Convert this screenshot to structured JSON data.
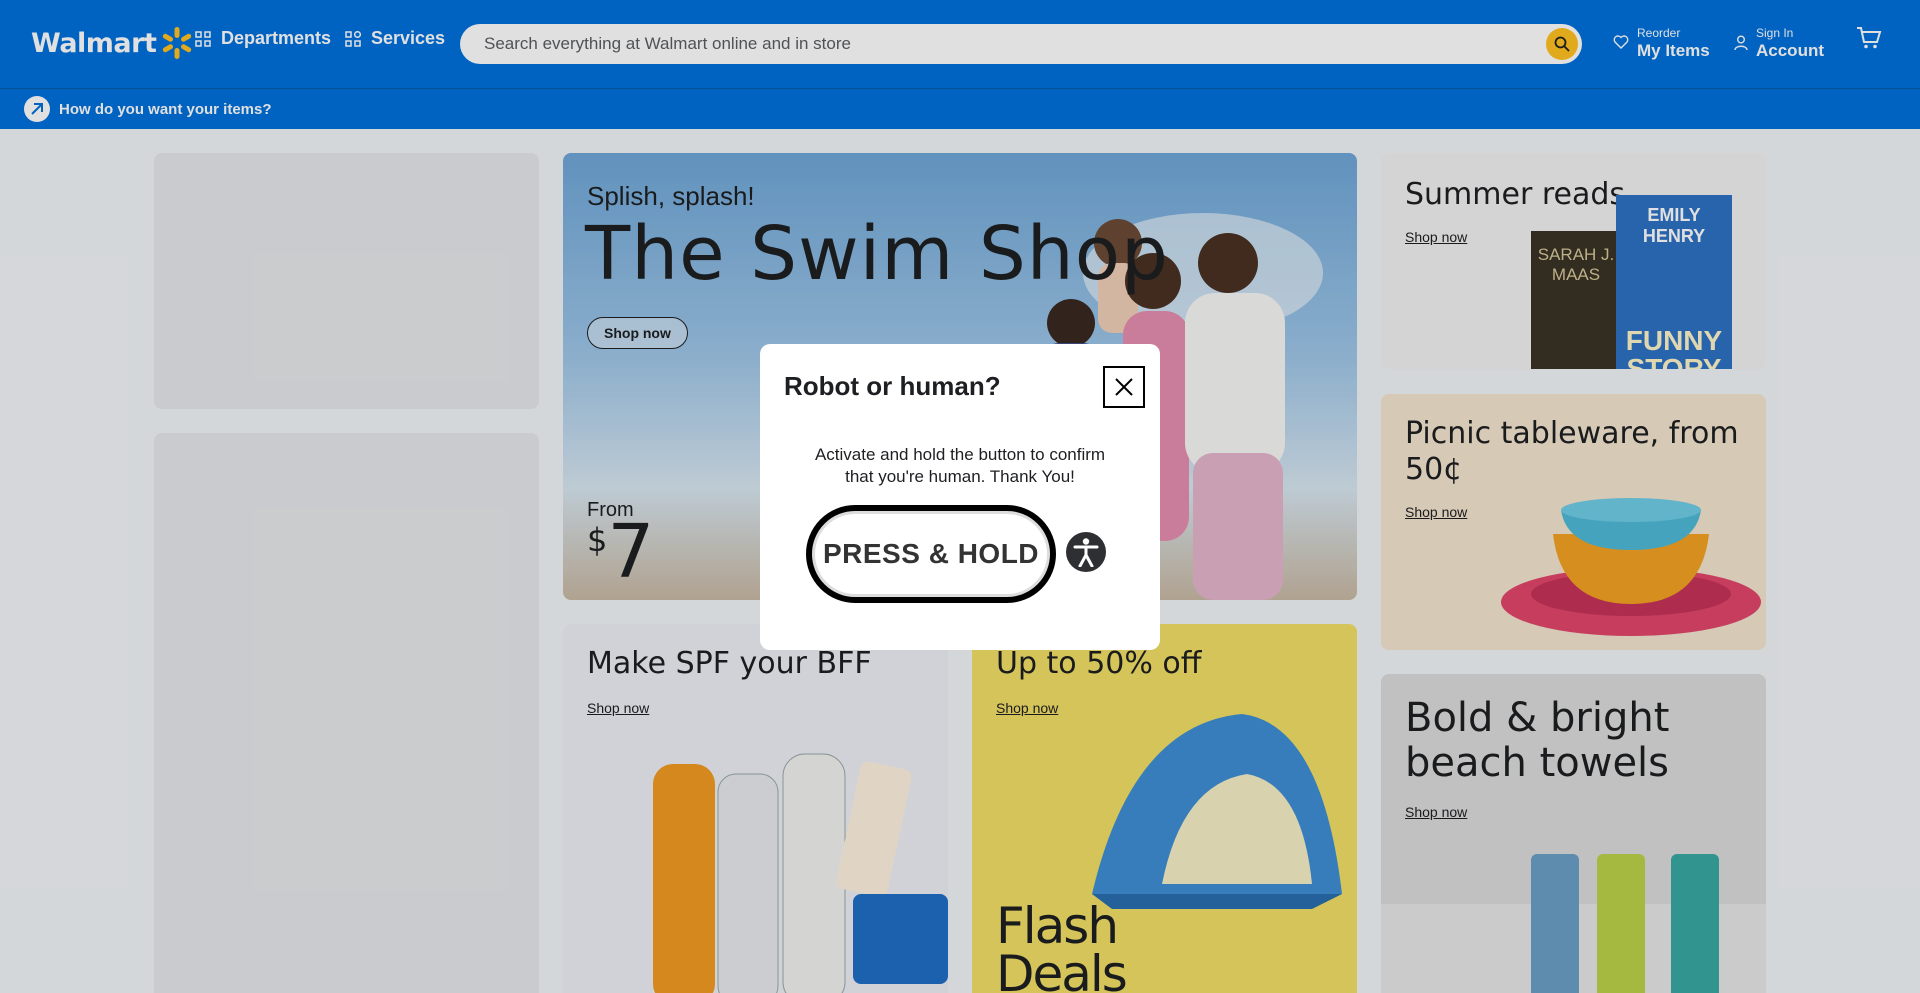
{
  "header": {
    "logo_text": "Walmart",
    "departments_label": "Departments",
    "services_label": "Services",
    "search_placeholder": "Search everything at Walmart online and in store",
    "reorder_small": "Reorder",
    "reorder_big": "My Items",
    "signin_small": "Sign In",
    "signin_big": "Account"
  },
  "subbar": {
    "label": "How do you want your items?"
  },
  "hero": {
    "kicker": "Splish, splash!",
    "title": "The Swim Shop",
    "button": "Shop now",
    "from_label": "From",
    "currency": "$",
    "price": "7"
  },
  "cards": {
    "summer_reads": {
      "title": "Summer reads",
      "link": "Shop now",
      "book1": "SARAH J. MAAS",
      "book2_author": "EMILY HENRY",
      "book2_title": "FUNNY STORY"
    },
    "picnic": {
      "title": "Picnic tableware, from 50¢",
      "link": "Shop now"
    },
    "spf": {
      "title": "Make SPF your BFF",
      "link": "Shop now"
    },
    "sale": {
      "title": "Up to 50% off",
      "link": "Shop now",
      "flash": "Flash",
      "deals": "Deals"
    },
    "towels": {
      "title": "Bold & bright beach towels",
      "link": "Shop now"
    }
  },
  "modal": {
    "title": "Robot or human?",
    "message": "Activate and hold the button to confirm that you're human. Thank You!",
    "button": "PRESS & HOLD"
  },
  "colors": {
    "brand_blue": "#0071dc",
    "spark_yellow": "#ffc220"
  }
}
